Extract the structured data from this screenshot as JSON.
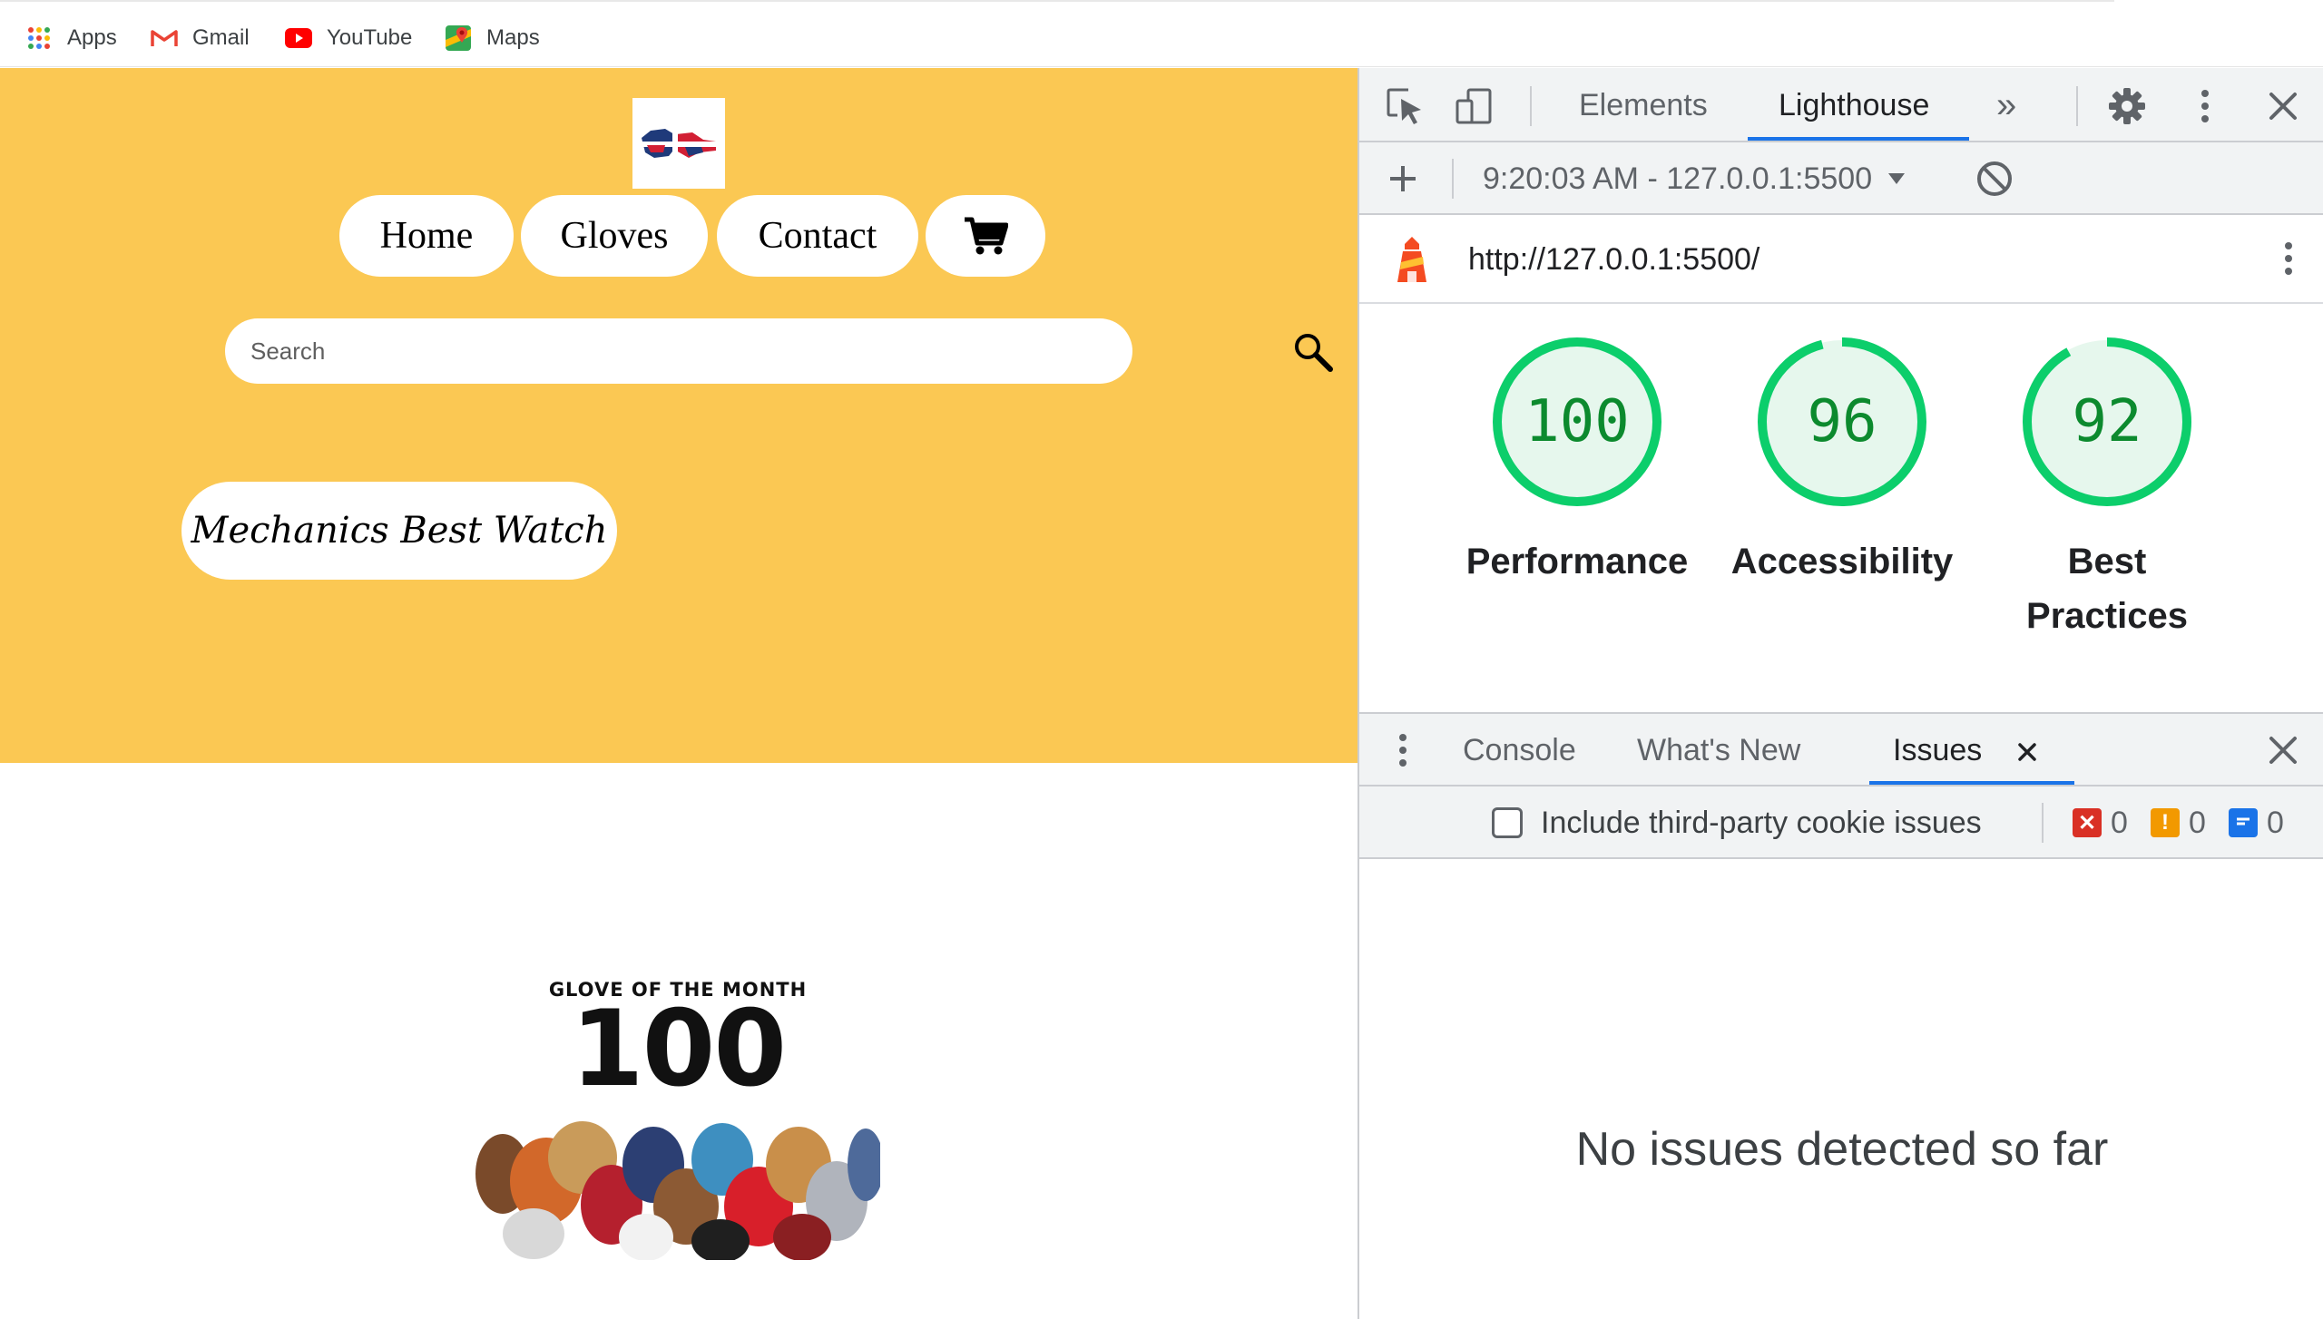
{
  "bookmarks": [
    {
      "label": "Apps",
      "icon": "apps-grid-icon"
    },
    {
      "label": "Gmail",
      "icon": "gmail-icon"
    },
    {
      "label": "YouTube",
      "icon": "youtube-icon"
    },
    {
      "label": "Maps",
      "icon": "maps-icon"
    }
  ],
  "site": {
    "nav": {
      "home": "Home",
      "gloves": "Gloves",
      "contact": "Contact",
      "cart_icon": "cart-icon"
    },
    "search": {
      "placeholder": "Search",
      "value": ""
    },
    "feature_button": "Mechanics Best Watch",
    "glove_of_month": {
      "caption": "GLOVE OF THE MONTH",
      "number": "100"
    },
    "colors": {
      "hero_bg": "#fbc853"
    }
  },
  "devtools": {
    "tabs": {
      "elements": "Elements",
      "lighthouse": "Lighthouse",
      "more": "»"
    },
    "report_selector": "9:20:03 AM - 127.0.0.1:5500",
    "url": "http://127.0.0.1:5500/",
    "scores": [
      {
        "label": "Performance",
        "value": "100",
        "fraction": 1.0
      },
      {
        "label": "Accessibility",
        "value": "96",
        "fraction": 0.96
      },
      {
        "label": "Best Practices",
        "value": "92",
        "fraction": 0.92
      }
    ],
    "drawer": {
      "tabs": {
        "console": "Console",
        "whats_new": "What's New",
        "issues": "Issues"
      },
      "checkbox_label": "Include third-party cookie issues",
      "counts": {
        "errors": "0",
        "warnings": "0",
        "info": "0"
      },
      "empty_message": "No issues detected so far"
    },
    "colors": {
      "accent": "#1a73e8",
      "pass": "#0cce6b",
      "pass_text": "#0c8a2e"
    }
  }
}
